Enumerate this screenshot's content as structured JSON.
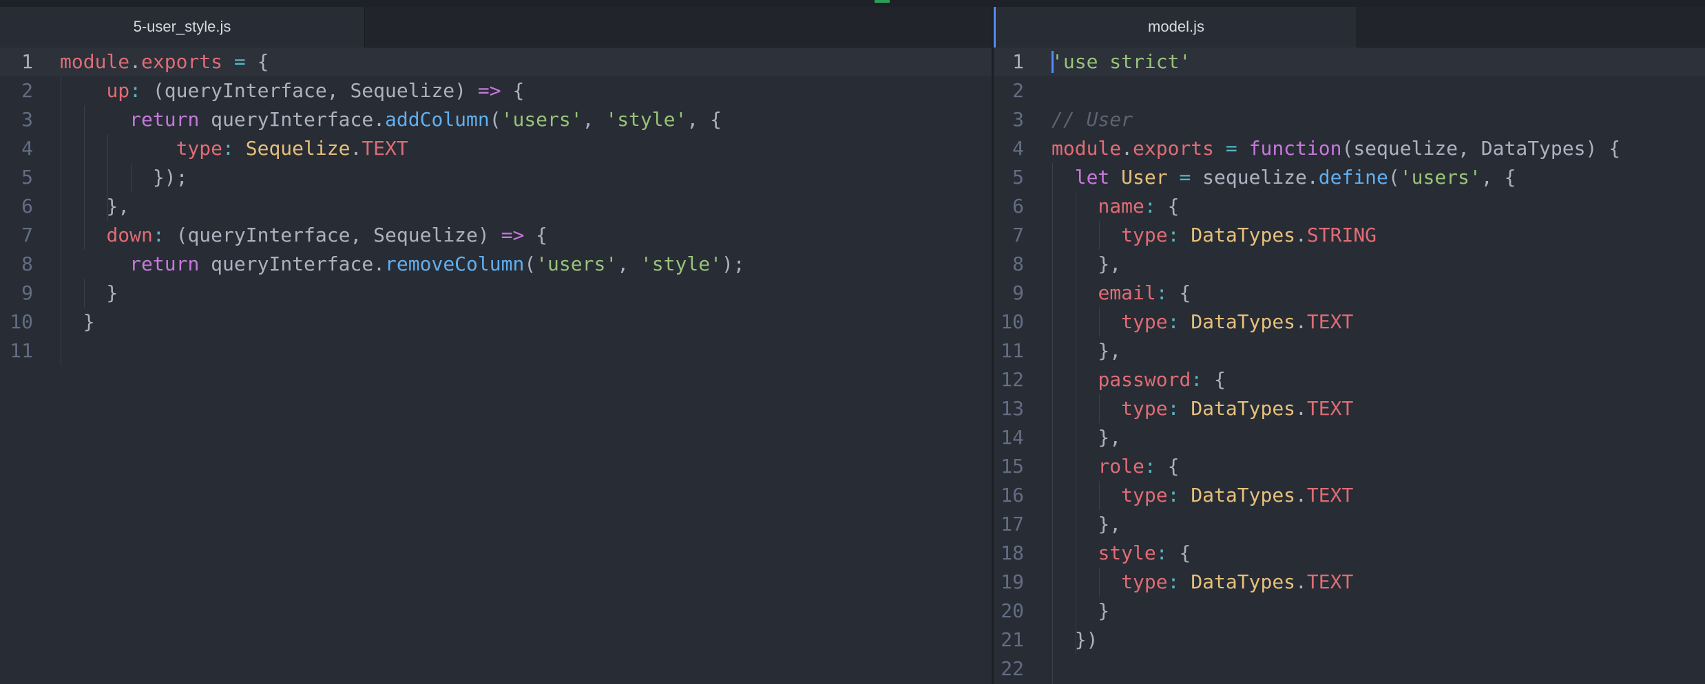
{
  "left_pane": {
    "tab_title": "5-user_style.js",
    "lines": [
      {
        "n": "1",
        "tokens": [
          [
            "module",
            "t-var"
          ],
          [
            ".",
            "t-plain"
          ],
          [
            "exports",
            "t-var"
          ],
          [
            " = ",
            "t-op"
          ],
          [
            "{",
            "t-plain"
          ]
        ]
      },
      {
        "n": "2",
        "tokens": [
          [
            "    ",
            "t-plain"
          ],
          [
            "up",
            "t-prop"
          ],
          [
            ": ",
            "t-op"
          ],
          [
            "(queryInterface, Sequelize) ",
            "t-plain"
          ],
          [
            "=>",
            "t-kw"
          ],
          [
            " {",
            "t-plain"
          ]
        ]
      },
      {
        "n": "3",
        "tokens": [
          [
            "      ",
            "t-plain"
          ],
          [
            "return",
            "t-kw"
          ],
          [
            " queryInterface.",
            "t-plain"
          ],
          [
            "addColumn",
            "t-fn"
          ],
          [
            "(",
            "t-plain"
          ],
          [
            "'users'",
            "t-str"
          ],
          [
            ", ",
            "t-plain"
          ],
          [
            "'style'",
            "t-str"
          ],
          [
            ", {",
            "t-plain"
          ]
        ]
      },
      {
        "n": "4",
        "tokens": [
          [
            "          ",
            "t-plain"
          ],
          [
            "type",
            "t-prop"
          ],
          [
            ": ",
            "t-op"
          ],
          [
            "Sequelize",
            "t-cls"
          ],
          [
            ".",
            "t-plain"
          ],
          [
            "TEXT",
            "t-var"
          ]
        ]
      },
      {
        "n": "5",
        "tokens": [
          [
            "        });",
            "t-plain"
          ]
        ]
      },
      {
        "n": "6",
        "tokens": [
          [
            "    },",
            "t-plain"
          ]
        ]
      },
      {
        "n": "7",
        "tokens": [
          [
            "    ",
            "t-plain"
          ],
          [
            "down",
            "t-prop"
          ],
          [
            ": ",
            "t-op"
          ],
          [
            "(queryInterface, Sequelize) ",
            "t-plain"
          ],
          [
            "=>",
            "t-kw"
          ],
          [
            " {",
            "t-plain"
          ]
        ]
      },
      {
        "n": "8",
        "tokens": [
          [
            "      ",
            "t-plain"
          ],
          [
            "return",
            "t-kw"
          ],
          [
            " queryInterface.",
            "t-plain"
          ],
          [
            "removeColumn",
            "t-fn"
          ],
          [
            "(",
            "t-plain"
          ],
          [
            "'users'",
            "t-str"
          ],
          [
            ", ",
            "t-plain"
          ],
          [
            "'style'",
            "t-str"
          ],
          [
            ");",
            "t-plain"
          ]
        ]
      },
      {
        "n": "9",
        "tokens": [
          [
            "    }",
            "t-plain"
          ]
        ]
      },
      {
        "n": "10",
        "tokens": [
          [
            "  }",
            "t-plain"
          ]
        ]
      },
      {
        "n": "11",
        "tokens": []
      }
    ]
  },
  "right_pane": {
    "tab_title": "model.js",
    "lines": [
      {
        "n": "1",
        "tokens": [
          [
            "'use strict'",
            "t-str"
          ]
        ]
      },
      {
        "n": "2",
        "tokens": []
      },
      {
        "n": "3",
        "tokens": [
          [
            "// User",
            "t-com"
          ]
        ]
      },
      {
        "n": "4",
        "tokens": [
          [
            "module",
            "t-var"
          ],
          [
            ".",
            "t-plain"
          ],
          [
            "exports",
            "t-var"
          ],
          [
            " = ",
            "t-op"
          ],
          [
            "function",
            "t-kw"
          ],
          [
            "(sequelize, DataTypes) {",
            "t-plain"
          ]
        ]
      },
      {
        "n": "5",
        "tokens": [
          [
            "  ",
            "t-plain"
          ],
          [
            "let",
            "t-kw"
          ],
          [
            " ",
            "t-plain"
          ],
          [
            "User",
            "t-cls"
          ],
          [
            " = ",
            "t-op"
          ],
          [
            "sequelize.",
            "t-plain"
          ],
          [
            "define",
            "t-fn"
          ],
          [
            "(",
            "t-plain"
          ],
          [
            "'users'",
            "t-str"
          ],
          [
            ", {",
            "t-plain"
          ]
        ]
      },
      {
        "n": "6",
        "tokens": [
          [
            "    ",
            "t-plain"
          ],
          [
            "name",
            "t-prop"
          ],
          [
            ": ",
            "t-op"
          ],
          [
            "{",
            "t-plain"
          ]
        ]
      },
      {
        "n": "7",
        "tokens": [
          [
            "      ",
            "t-plain"
          ],
          [
            "type",
            "t-prop"
          ],
          [
            ": ",
            "t-op"
          ],
          [
            "DataTypes",
            "t-cls"
          ],
          [
            ".",
            "t-plain"
          ],
          [
            "STRING",
            "t-var"
          ]
        ]
      },
      {
        "n": "8",
        "tokens": [
          [
            "    },",
            "t-plain"
          ]
        ]
      },
      {
        "n": "9",
        "tokens": [
          [
            "    ",
            "t-plain"
          ],
          [
            "email",
            "t-prop"
          ],
          [
            ": ",
            "t-op"
          ],
          [
            "{",
            "t-plain"
          ]
        ]
      },
      {
        "n": "10",
        "tokens": [
          [
            "      ",
            "t-plain"
          ],
          [
            "type",
            "t-prop"
          ],
          [
            ": ",
            "t-op"
          ],
          [
            "DataTypes",
            "t-cls"
          ],
          [
            ".",
            "t-plain"
          ],
          [
            "TEXT",
            "t-var"
          ]
        ]
      },
      {
        "n": "11",
        "tokens": [
          [
            "    },",
            "t-plain"
          ]
        ]
      },
      {
        "n": "12",
        "tokens": [
          [
            "    ",
            "t-plain"
          ],
          [
            "password",
            "t-prop"
          ],
          [
            ": ",
            "t-op"
          ],
          [
            "{",
            "t-plain"
          ]
        ]
      },
      {
        "n": "13",
        "tokens": [
          [
            "      ",
            "t-plain"
          ],
          [
            "type",
            "t-prop"
          ],
          [
            ": ",
            "t-op"
          ],
          [
            "DataTypes",
            "t-cls"
          ],
          [
            ".",
            "t-plain"
          ],
          [
            "TEXT",
            "t-var"
          ]
        ]
      },
      {
        "n": "14",
        "tokens": [
          [
            "    },",
            "t-plain"
          ]
        ]
      },
      {
        "n": "15",
        "tokens": [
          [
            "    ",
            "t-plain"
          ],
          [
            "role",
            "t-prop"
          ],
          [
            ": ",
            "t-op"
          ],
          [
            "{",
            "t-plain"
          ]
        ]
      },
      {
        "n": "16",
        "tokens": [
          [
            "      ",
            "t-plain"
          ],
          [
            "type",
            "t-prop"
          ],
          [
            ": ",
            "t-op"
          ],
          [
            "DataTypes",
            "t-cls"
          ],
          [
            ".",
            "t-plain"
          ],
          [
            "TEXT",
            "t-var"
          ]
        ]
      },
      {
        "n": "17",
        "tokens": [
          [
            "    },",
            "t-plain"
          ]
        ]
      },
      {
        "n": "18",
        "tokens": [
          [
            "    ",
            "t-plain"
          ],
          [
            "style",
            "t-prop"
          ],
          [
            ": ",
            "t-op"
          ],
          [
            "{",
            "t-plain"
          ]
        ]
      },
      {
        "n": "19",
        "tokens": [
          [
            "      ",
            "t-plain"
          ],
          [
            "type",
            "t-prop"
          ],
          [
            ": ",
            "t-op"
          ],
          [
            "DataTypes",
            "t-cls"
          ],
          [
            ".",
            "t-plain"
          ],
          [
            "TEXT",
            "t-var"
          ]
        ]
      },
      {
        "n": "20",
        "tokens": [
          [
            "    }",
            "t-plain"
          ]
        ]
      },
      {
        "n": "21",
        "tokens": [
          [
            "  })",
            "t-plain"
          ]
        ]
      },
      {
        "n": "22",
        "tokens": []
      }
    ]
  },
  "colors": {
    "background": "#282c34",
    "tabbar": "#21252b",
    "cursor": "#528bff",
    "string": "#98c379",
    "keyword": "#c678dd",
    "function": "#61afef",
    "variable": "#e06c75",
    "class": "#e5c07b"
  }
}
